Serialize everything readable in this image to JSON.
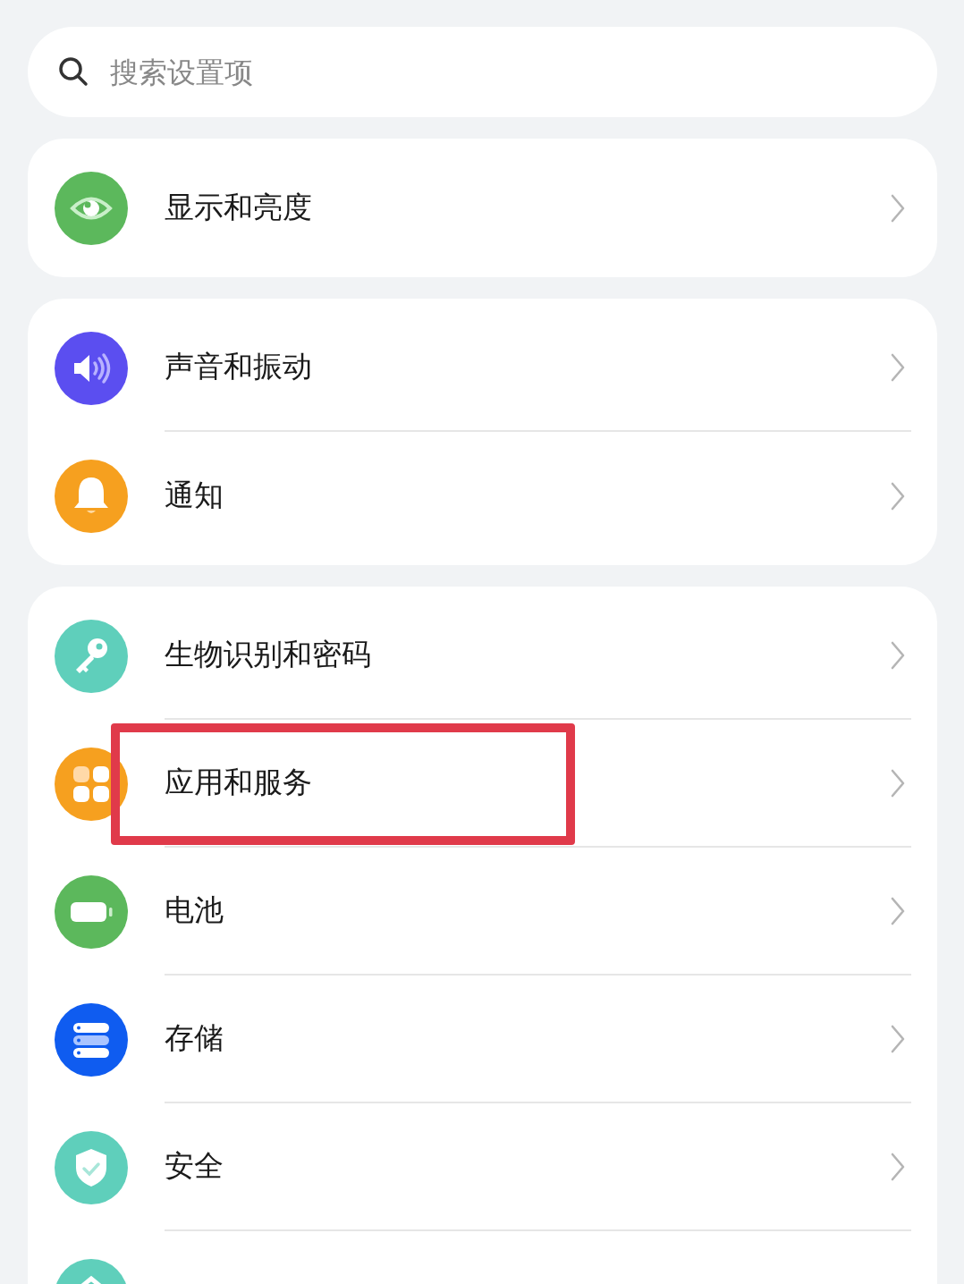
{
  "search": {
    "placeholder": "搜索设置项"
  },
  "groups": [
    {
      "items": [
        {
          "label": "显示和亮度",
          "kind": "eye",
          "color": "#5cb85c",
          "highlighted": false
        }
      ]
    },
    {
      "items": [
        {
          "label": "声音和振动",
          "kind": "speaker",
          "color": "#5b4ef0",
          "highlighted": false
        },
        {
          "label": "通知",
          "kind": "bell",
          "color": "#f6a01f",
          "highlighted": false
        }
      ]
    },
    {
      "items": [
        {
          "label": "生物识别和密码",
          "kind": "key",
          "color": "#5fcfbb",
          "highlighted": false
        },
        {
          "label": "应用和服务",
          "kind": "apps",
          "color": "#f6a01f",
          "highlighted": true
        },
        {
          "label": "电池",
          "kind": "battery",
          "color": "#5cb85c",
          "highlighted": false
        },
        {
          "label": "存储",
          "kind": "storage",
          "color": "#0f5cf0",
          "highlighted": false
        },
        {
          "label": "安全",
          "kind": "shield",
          "color": "#5fcfbb",
          "highlighted": false
        },
        {
          "kind": "privacy",
          "color": "#5fcfbb",
          "highlighted": false
        }
      ]
    }
  ]
}
